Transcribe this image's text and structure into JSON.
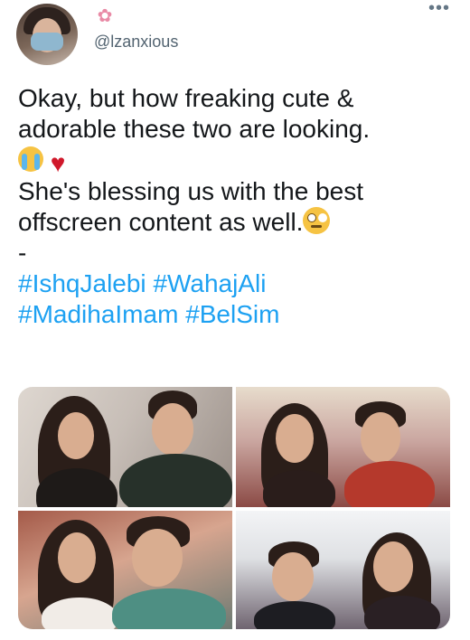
{
  "user": {
    "handle": "@lzanxious",
    "flower_icon": "cherry-blossom-icon",
    "more_icon": "more-horizontal-icon"
  },
  "tweet": {
    "line1": "Okay, but how freaking cute &",
    "line2": "adorable these two are looking.",
    "line4": "She's blessing us with the best",
    "line5": "offscreen content as well.",
    "dash": "-",
    "hashtags": [
      "#IshqJalebi",
      "#WahajAli",
      "#MadihaImam",
      "#BelSim"
    ],
    "emoji_line3": [
      "loudly-crying-face",
      "red-heart"
    ],
    "emoji_line5": "face-with-rolling-eyes"
  },
  "colors": {
    "text": "#14171a",
    "hashtag": "#1da1f2",
    "handle": "#536471"
  },
  "media": {
    "photo_count": 4
  }
}
